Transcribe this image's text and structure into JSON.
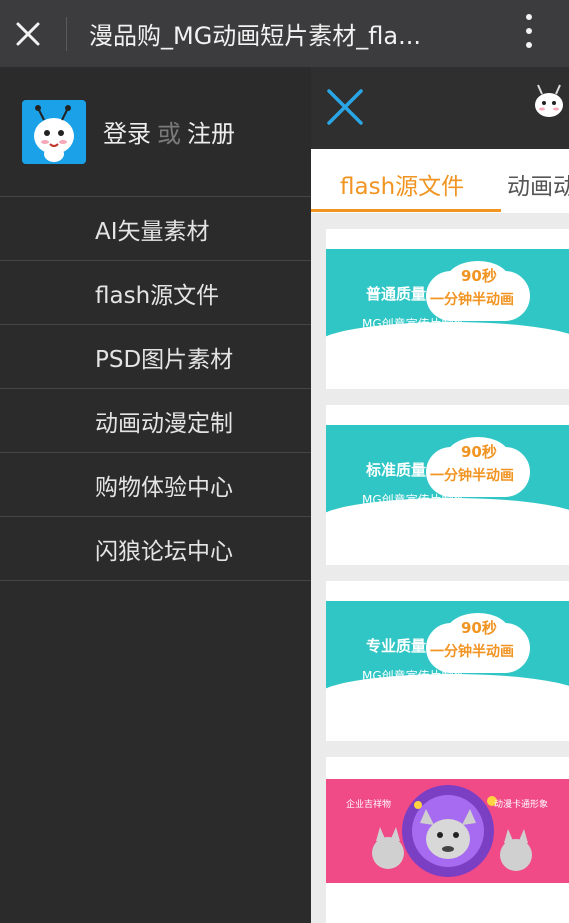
{
  "browser": {
    "title": "漫品购_MG动画短片素材_fla..."
  },
  "drawer": {
    "login": "登录",
    "or": "或",
    "register": "注册",
    "items": [
      {
        "label": "AI矢量素材"
      },
      {
        "label": "flash源文件"
      },
      {
        "label": "PSD图片素材"
      },
      {
        "label": "动画动漫定制"
      },
      {
        "label": "购物体验中心"
      },
      {
        "label": "闪狼论坛中心"
      }
    ]
  },
  "page": {
    "tabs": [
      {
        "label": "flash源文件"
      },
      {
        "label": "动画动"
      }
    ],
    "cards": [
      {
        "quality": "普通质量",
        "badge": "90秒",
        "headline": "一分钟半动画",
        "sub": "MG创意宣传片制作"
      },
      {
        "quality": "标准质量",
        "badge": "90秒",
        "headline": "一分钟半动画",
        "sub": "MG创意宣传片制作"
      },
      {
        "quality": "专业质量",
        "badge": "90秒",
        "headline": "一分钟半动画",
        "sub": "MG创意宣传片制作"
      },
      {
        "left_text": "企业吉祥物",
        "right_text": "动漫卡通形象"
      }
    ]
  },
  "colors": {
    "accent": "#f19422",
    "banner_teal": "#2fc6c5",
    "banner_pink": "#f04a87",
    "avatar_blue": "#1aa1e8"
  }
}
